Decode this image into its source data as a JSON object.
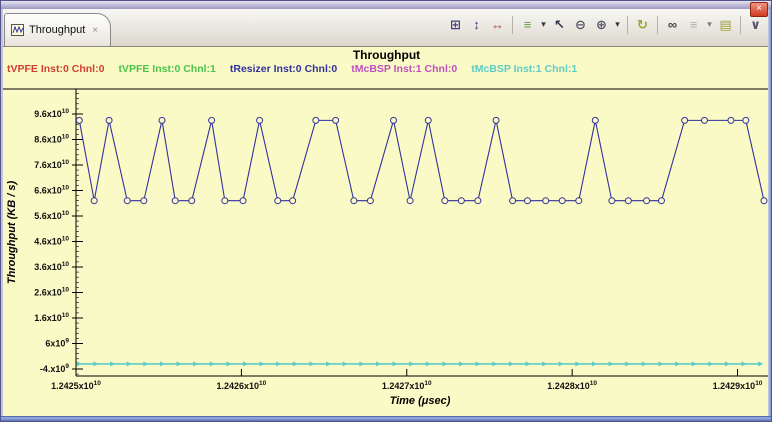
{
  "window": {
    "close_glyph": "×"
  },
  "tab": {
    "label": "Throughput",
    "close_glyph": "×"
  },
  "toolbar": {
    "icons": [
      {
        "name": "fit-graph-icon",
        "glyph": "⊞",
        "color": "#44447a"
      },
      {
        "name": "fit-vertical-icon",
        "glyph": "↕",
        "color": "#44447a"
      },
      {
        "name": "fit-horizontal-icon",
        "glyph": "↔",
        "color": "#a84848"
      },
      {
        "name": "zoom-region-icon",
        "glyph": "≡",
        "color": "#6a9a4a"
      },
      {
        "name": "dropdown-arrow-icon",
        "glyph": "▾",
        "color": "#333333"
      },
      {
        "name": "pointer-icon",
        "glyph": "↖",
        "color": "#333344"
      },
      {
        "name": "zoom-out-icon",
        "glyph": "⊖",
        "color": "#555566"
      },
      {
        "name": "zoom-in-icon",
        "glyph": "⊕",
        "color": "#555566"
      },
      {
        "name": "dropdown-arrow-icon",
        "glyph": "▾",
        "color": "#333333"
      },
      {
        "name": "refresh-icon",
        "glyph": "↻",
        "color": "#96a32c"
      },
      {
        "name": "binoculars-icon",
        "glyph": "∞",
        "color": "#444444"
      },
      {
        "name": "menu-icon",
        "glyph": "≡",
        "color": "#b0b0b0"
      },
      {
        "name": "dropdown-arrow-icon",
        "glyph": "▾",
        "color": "#777777"
      },
      {
        "name": "chart-view-icon",
        "glyph": "▤",
        "color": "#a0a040"
      },
      {
        "name": "chevron-icon",
        "glyph": "∨",
        "color": "#555566"
      }
    ]
  },
  "chart_data": {
    "type": "line",
    "title": "Throughput",
    "xlabel": "Time (μsec)",
    "ylabel": "Throughput  (KB / s)",
    "background": "#fafac6",
    "legend_position": "top",
    "grid": false,
    "xlim": [
      12425000000,
      12429160000
    ],
    "ylim": [
      -6750000000,
      105800000000
    ],
    "x_minor_step": 50000000,
    "y_minor_step": 2000000000,
    "x_ticks": [
      {
        "value": 12425000000,
        "base": "1.2425x10",
        "exp": "10"
      },
      {
        "value": 12426000000,
        "base": "1.2426x10",
        "exp": "10"
      },
      {
        "value": 12427000000,
        "base": "1.2427x10",
        "exp": "10"
      },
      {
        "value": 12428000000,
        "base": "1.2428x10",
        "exp": "10"
      },
      {
        "value": 12429000000,
        "base": "1.2429x10",
        "exp": "10"
      }
    ],
    "y_ticks": [
      {
        "value": 96000000000,
        "base": "9.6x10",
        "exp": "10"
      },
      {
        "value": 86000000000,
        "base": "8.6x10",
        "exp": "10"
      },
      {
        "value": 76000000000,
        "base": "7.6x10",
        "exp": "10"
      },
      {
        "value": 66000000000,
        "base": "6.6x10",
        "exp": "10"
      },
      {
        "value": 56000000000,
        "base": "5.6x10",
        "exp": "10"
      },
      {
        "value": 46000000000,
        "base": "4.6x10",
        "exp": "10"
      },
      {
        "value": 36000000000,
        "base": "3.6x10",
        "exp": "10"
      },
      {
        "value": 26000000000,
        "base": "2.6x10",
        "exp": "10"
      },
      {
        "value": 16000000000,
        "base": "1.6x10",
        "exp": "10"
      },
      {
        "value": 6000000000,
        "base": "6x10",
        "exp": "9"
      },
      {
        "value": -4000000000,
        "base": "-4.x10",
        "exp": "9"
      }
    ],
    "series": [
      {
        "name": "tVPFE Inst:0 Chnl:0",
        "color": "#d04030",
        "points": []
      },
      {
        "name": "tVPFE Inst:0 Chnl:1",
        "color": "#4cc44c",
        "points": []
      },
      {
        "name": "tResizer Inst:0 Chnl:0",
        "color": "#32329e",
        "marker": "circle",
        "points": [
          [
            12425020000,
            93500000000
          ],
          [
            12425110000,
            62000000000
          ],
          [
            12425200000,
            93500000000
          ],
          [
            12425310000,
            62000000000
          ],
          [
            12425410000,
            62000000000
          ],
          [
            12425520000,
            93500000000
          ],
          [
            12425600000,
            62000000000
          ],
          [
            12425700000,
            62000000000
          ],
          [
            12425820000,
            93500000000
          ],
          [
            12425900000,
            62000000000
          ],
          [
            12426010000,
            62000000000
          ],
          [
            12426110000,
            93500000000
          ],
          [
            12426220000,
            62000000000
          ],
          [
            12426310000,
            62000000000
          ],
          [
            12426450000,
            93500000000
          ],
          [
            12426570000,
            93500000000
          ],
          [
            12426680000,
            62000000000
          ],
          [
            12426780000,
            62000000000
          ],
          [
            12426920000,
            93500000000
          ],
          [
            12427020000,
            62000000000
          ],
          [
            12427130000,
            93500000000
          ],
          [
            12427230000,
            62000000000
          ],
          [
            12427330000,
            62000000000
          ],
          [
            12427430000,
            62000000000
          ],
          [
            12427540000,
            93500000000
          ],
          [
            12427640000,
            62000000000
          ],
          [
            12427730000,
            62000000000
          ],
          [
            12427840000,
            62000000000
          ],
          [
            12427940000,
            62000000000
          ],
          [
            12428040000,
            62000000000
          ],
          [
            12428140000,
            93500000000
          ],
          [
            12428240000,
            62000000000
          ],
          [
            12428340000,
            62000000000
          ],
          [
            12428450000,
            62000000000
          ],
          [
            12428540000,
            62000000000
          ],
          [
            12428680000,
            93500000000
          ],
          [
            12428800000,
            93500000000
          ],
          [
            12428960000,
            93500000000
          ],
          [
            12429050000,
            93500000000
          ],
          [
            12429160000,
            62000000000
          ]
        ]
      },
      {
        "name": "tMcBSP Inst:1 Chnl:0",
        "color": "#c050c0",
        "points": []
      },
      {
        "name": "tMcBSP Inst:1 Chnl:1",
        "color": "#5eccc4",
        "marker": "triangle",
        "flat_value": -2000000000,
        "flat_range": [
          12425020000,
          12429140000
        ],
        "marker_count": 42
      }
    ]
  }
}
